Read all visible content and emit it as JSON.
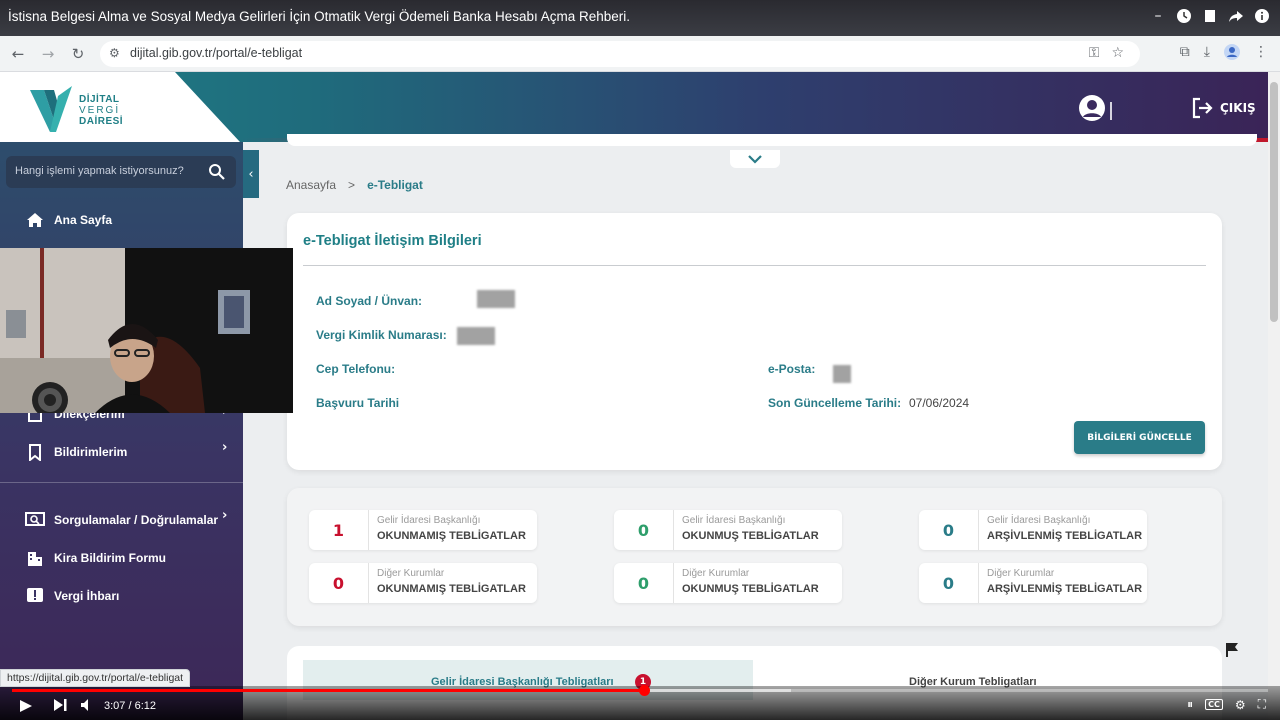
{
  "youtube": {
    "title": "İstisna Belgesi Alma ve Sosyal Medya Gelirleri İçin Otmatik Vergi Ödemeli Banka Hesabı Açma Rehberi.",
    "time_display": "3:07 / 6:12",
    "progress_fraction": 0.503,
    "buffered_fraction": 0.62
  },
  "browser": {
    "url": "dijital.gib.gov.tr/portal/e-tebligat",
    "status_url": "https://dijital.gib.gov.tr/portal/e-tebligat"
  },
  "header": {
    "logo_line1": "DİJİTAL",
    "logo_line2": "VERGİ",
    "logo_line3": "DAİRESİ",
    "logout_label": "ÇIKIŞ"
  },
  "sidebar": {
    "search_placeholder": "Hangi işlemi yapmak istiyorsunuz?",
    "home_label": "Ana Sayfa",
    "petitions_label": "Dilekçelerim",
    "notifications_label": "Bildirimlerim",
    "queries_label": "Sorgulamalar / Doğrulamalar",
    "rent_label": "Kira Bildirim Formu",
    "report_label": "Vergi İhbarı"
  },
  "breadcrumb": {
    "home": "Anasayfa",
    "separator": ">",
    "current": "e-Tebligat"
  },
  "contact_card": {
    "title": "e-Tebligat İletişim Bilgileri",
    "name_label": "Ad Soyad / Ünvan:",
    "tax_id_label": "Vergi Kimlik Numarası:",
    "phone_label": "Cep Telefonu:",
    "email_label": "e-Posta:",
    "apply_date_label": "Başvuru Tarihi",
    "last_update_label": "Son Güncelleme Tarihi:",
    "last_update_value": "07/06/2024",
    "update_button": "BİLGİLERİ GÜNCELLE"
  },
  "stats": [
    {
      "value": "1",
      "source": "Gelir İdaresi Başkanlığı",
      "label": "OKUNMAMIŞ TEBLİGATLAR",
      "color": "#c8102e"
    },
    {
      "value": "0",
      "source": "Gelir İdaresi Başkanlığı",
      "label": "OKUNMUŞ TEBLİGATLAR",
      "color": "#2e9e6b"
    },
    {
      "value": "0",
      "source": "Gelir İdaresi Başkanlığı",
      "label": "ARŞİVLENMİŞ TEBLİGATLAR",
      "color": "#2a7c88"
    },
    {
      "value": "0",
      "source": "Diğer Kurumlar",
      "label": "OKUNMAMIŞ TEBLİGATLAR",
      "color": "#c8102e"
    },
    {
      "value": "0",
      "source": "Diğer Kurumlar",
      "label": "OKUNMUŞ TEBLİGATLAR",
      "color": "#2e9e6b"
    },
    {
      "value": "0",
      "source": "Diğer Kurumlar",
      "label": "ARŞİVLENMİŞ TEBLİGATLAR",
      "color": "#2a7c88"
    }
  ],
  "tabs": {
    "gib_label": "Gelir İdaresi Başkanlığı Tebligatları",
    "gib_badge": "1",
    "other_label": "Diğer Kurum Tebligatları"
  },
  "colors": {
    "accent": "#2a7c88",
    "brand_red": "#e0283c"
  }
}
